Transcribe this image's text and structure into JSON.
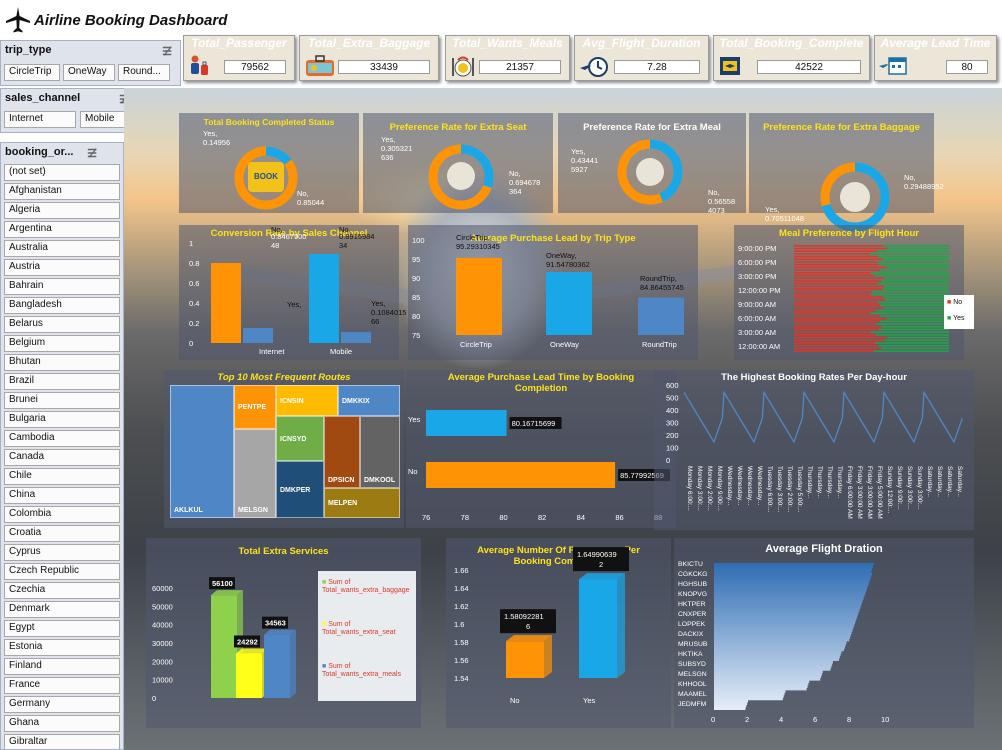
{
  "header": {
    "title": "Airline Booking Dashboard",
    "icon": "airplane-icon"
  },
  "kpis": [
    {
      "label": "Total_Passenger",
      "value": "79562",
      "icon": "passenger-icon"
    },
    {
      "label": "Total_Extra_Baggage",
      "value": "33439",
      "icon": "baggage-icon"
    },
    {
      "label": "Total_Wants_Meals",
      "value": "21357",
      "icon": "meal-icon"
    },
    {
      "label": "Avg_Flight_Duration",
      "value": "7.28",
      "icon": "flight-clock-icon"
    },
    {
      "label": "Total_Booking_Complete",
      "value": "42522",
      "icon": "booking-icon"
    },
    {
      "label": "Average Lead Time",
      "value": "80",
      "icon": "calendar-plane-icon"
    }
  ],
  "slicers": {
    "trip_type": {
      "title": "trip_type",
      "items": [
        "CircleTrip",
        "OneWay",
        "Round..."
      ]
    },
    "sales_channel": {
      "title": "sales_channel",
      "items": [
        "Internet",
        "Mobile"
      ]
    },
    "booking_origin": {
      "title": "booking_or...",
      "items": [
        "(not set)",
        "Afghanistan",
        "Algeria",
        "Argentina",
        "Australia",
        "Austria",
        "Bahrain",
        "Bangladesh",
        "Belarus",
        "Belgium",
        "Bhutan",
        "Brazil",
        "Brunei",
        "Bulgaria",
        "Cambodia",
        "Canada",
        "Chile",
        "China",
        "Colombia",
        "Croatia",
        "Cyprus",
        "Czech Republic",
        "Czechia",
        "Denmark",
        "Egypt",
        "Estonia",
        "Finland",
        "France",
        "Germany",
        "Ghana",
        "Gibraltar"
      ]
    }
  },
  "donuts": [
    {
      "title": "Total Booking Completed Status",
      "yes_label": "Yes,",
      "yes_value": "0.14956",
      "no_label": "No,",
      "no_value": "0.85044",
      "center": "BOOK",
      "yes": 0.14956,
      "no": 0.85044
    },
    {
      "title": "Preference Rate for Extra Seat",
      "yes_label": "Yes,",
      "yes_value": "0.305321",
      "yes_value2": "636",
      "no_label": "No,",
      "no_value": "0.694678",
      "no_value2": "364",
      "yes": 0.305321636,
      "no": 0.694678364
    },
    {
      "title": "Preference Rate for Extra Meal",
      "yes_label": "Yes,",
      "yes_value": "0.43441",
      "yes_value2": "5927",
      "no_label": "No,",
      "no_value": "0.56558",
      "no_value2": "4073",
      "yes": 0.434415927,
      "no": 0.565584073
    },
    {
      "title": "Preference Rate for Extra Baggage",
      "yes_label": "Yes,",
      "yes_value": "0.70511048",
      "no_label": "No,",
      "no_value": "0.29488952",
      "yes": 0.70511048,
      "no": 0.29488952
    }
  ],
  "chart_data": [
    {
      "type": "bar",
      "title": "Conversion Rate by Sales Channel",
      "categories": [
        "Internet",
        "Mobile"
      ],
      "series": [
        {
          "name": "No",
          "values": [
            0.8,
            0.89
          ]
        },
        {
          "name": "Yes",
          "values": [
            0.15,
            0.1084015
          ]
        }
      ],
      "labels": {
        "no_internet": "No,",
        "no_internet_v1": "0.8467500",
        "no_internet_v2": "48",
        "no_mobile": "No,",
        "no_mobile_v1": "0.8915984",
        "no_mobile_v2": "34",
        "yes_internet": "Yes,",
        "yes_mobile": "Yes,",
        "yes_mobile_v1": "0.1084015",
        "yes_mobile_v2": "66"
      },
      "yticks": [
        "1",
        "0.8",
        "0.6",
        "0.4",
        "0.2",
        "0"
      ],
      "ylim": [
        0,
        1
      ]
    },
    {
      "type": "bar",
      "title": "Average Purchase Lead by Trip Type",
      "categories": [
        "CircleTrip",
        "OneWay",
        "RoundTrip"
      ],
      "values": [
        95.29310345,
        91.54780362,
        84.86455745
      ],
      "labels": [
        "CircleTrip,",
        "95.29310345",
        "OneWay,",
        "91.54780362",
        "RoundTrip,",
        "84.86455745"
      ],
      "yticks": [
        "100",
        "95",
        "90",
        "85",
        "80",
        "75"
      ],
      "ylim": [
        75,
        100
      ]
    },
    {
      "type": "bar",
      "title": "Meal Preference by Flight Hour",
      "categories": [
        "9:00:00 PM",
        "6:00:00 PM",
        "3:00:00 PM",
        "12:00:00 PM",
        "9:00:00 AM",
        "6:00:00 AM",
        "3:00:00 AM",
        "12:00:00 AM"
      ],
      "series": [
        {
          "name": "No",
          "color": "#d9392b"
        },
        {
          "name": "Yes",
          "color": "#23a34a"
        }
      ]
    },
    {
      "type": "heatmap",
      "title": "Top 10 Most Frequent Routes",
      "routes": [
        "AKLKUL",
        "PENTPE",
        "MELSGN",
        "ICNSIN",
        "ICNSYD",
        "DMKPER",
        "DMKKIX",
        "DPSICN",
        "DMKOOL",
        "MELPEN"
      ]
    },
    {
      "type": "bar",
      "title": "Average Purchase Lead Time by Booking Completion",
      "categories": [
        "Yes",
        "No"
      ],
      "values": [
        80.16715699,
        85.77992569
      ],
      "xticks": [
        "76",
        "78",
        "80",
        "82",
        "84",
        "86",
        "88"
      ],
      "xlim": [
        76,
        88
      ]
    },
    {
      "type": "line",
      "title": "The Highest Booking Rates Per Day-hour",
      "yticks": [
        "600",
        "500",
        "400",
        "300",
        "200",
        "100",
        "0"
      ],
      "ylim": [
        0,
        600
      ],
      "xlabels": [
        "Monday 6:00:...",
        "Monday 3:00:...",
        "Monday 2:00:...",
        "Monday 9:00:...",
        "Wednesday...",
        "Wednesday...",
        "Wednesday...",
        "Wednesday...",
        "Tuesday 6:00:...",
        "Tuesday 3:00:...",
        "Tuesday 2:00:...",
        "Tuesday 5:00:...",
        "Thursday...",
        "Thursday...",
        "Thursday...",
        "Thursday...",
        "Friday 6:00:00 AM",
        "Friday 3:00:00 AM",
        "Friday 3:00:00 AM",
        "Friday 5:00:00 AM",
        "Sunday 12:00:...",
        "Sunday 9:00:...",
        "Sunday 3:00:...",
        "Sunday 3:00:...",
        "Saturday...",
        "Saturday...",
        "Saturday...",
        "Saturday..."
      ]
    },
    {
      "type": "bar",
      "title": "Total Extra Services",
      "categories": [
        "Sum of Total_wants_extra_baggage",
        "Sum of Total_wants_extra_seat",
        "Sum of Total_wants_extra_meals"
      ],
      "values": [
        56100,
        24292,
        34563
      ],
      "labels": [
        "56100",
        "24292",
        "34563"
      ],
      "yticks": [
        "60000",
        "50000",
        "40000",
        "30000",
        "20000",
        "10000",
        "0"
      ],
      "ylim": [
        0,
        60000
      ],
      "legend": [
        "Sum of Total_wants_extra_baggage",
        "Sum of Total_wants_extra_seat",
        "Sum of Total_wants_extra_meals"
      ],
      "colors": [
        "#8ed14a",
        "#ffff18",
        "#4f86c6"
      ]
    },
    {
      "type": "bar",
      "title": "Average Number Of Passengers Per Booking Completed",
      "categories": [
        "No",
        "Yes"
      ],
      "values": [
        1.580922816,
        1.649906392
      ],
      "labels": [
        "1.58092281",
        "6",
        "1.64990639",
        "2"
      ],
      "yticks": [
        "1.66",
        "1.64",
        "1.62",
        "1.6",
        "1.58",
        "1.56",
        "1.54"
      ],
      "ylim": [
        1.54,
        1.66
      ]
    },
    {
      "type": "area",
      "title": "Average Flight Dration",
      "routes": [
        "BKICTU",
        "CGKCKG",
        "HGHSUB",
        "KNOPVG",
        "HKTPER",
        "CNXPER",
        "LOPPEK",
        "DACKIX",
        "MRUSUB",
        "HKTIKA",
        "SUBSYD",
        "MELSGN",
        "KHHOOL",
        "MAAMEL",
        "JEDMFM"
      ],
      "xticks": [
        "0",
        "2",
        "4",
        "6",
        "8",
        "10"
      ],
      "xlim": [
        0,
        10
      ]
    }
  ]
}
